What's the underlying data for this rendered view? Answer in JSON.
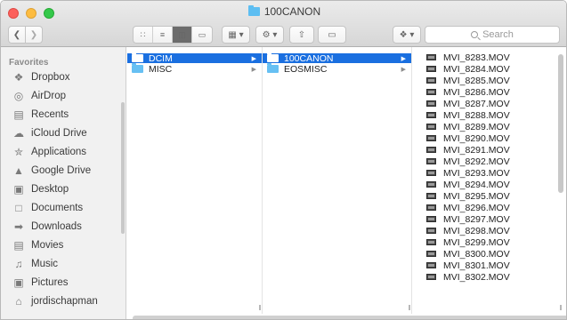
{
  "window": {
    "title": "100CANON"
  },
  "toolbar": {
    "back_icon": "chevron-left-icon",
    "forward_icon": "chevron-right-icon",
    "view_modes": [
      "icon-view-icon",
      "list-view-icon",
      "column-view-icon",
      "cover-flow-icon"
    ],
    "active_view": "column",
    "search_placeholder": "Search"
  },
  "sidebar": {
    "heading": "Favorites",
    "items": [
      {
        "label": "Dropbox",
        "icon": "dropbox-icon"
      },
      {
        "label": "AirDrop",
        "icon": "airdrop-icon"
      },
      {
        "label": "Recents",
        "icon": "recents-icon"
      },
      {
        "label": "iCloud Drive",
        "icon": "cloud-icon"
      },
      {
        "label": "Applications",
        "icon": "applications-icon"
      },
      {
        "label": "Google Drive",
        "icon": "google-drive-icon"
      },
      {
        "label": "Desktop",
        "icon": "desktop-icon"
      },
      {
        "label": "Documents",
        "icon": "documents-icon"
      },
      {
        "label": "Downloads",
        "icon": "downloads-icon"
      },
      {
        "label": "Movies",
        "icon": "movies-icon"
      },
      {
        "label": "Music",
        "icon": "music-icon"
      },
      {
        "label": "Pictures",
        "icon": "pictures-icon"
      },
      {
        "label": "jordischapman",
        "icon": "home-icon"
      }
    ]
  },
  "columns": {
    "col1": [
      {
        "name": "DCIM",
        "selected": true
      },
      {
        "name": "MISC",
        "selected": false
      }
    ],
    "col2": [
      {
        "name": "100CANON",
        "selected": true
      },
      {
        "name": "EOSMISC",
        "selected": false
      }
    ],
    "col3": [
      "MVI_8283.MOV",
      "MVI_8284.MOV",
      "MVI_8285.MOV",
      "MVI_8286.MOV",
      "MVI_8287.MOV",
      "MVI_8288.MOV",
      "MVI_8289.MOV",
      "MVI_8290.MOV",
      "MVI_8291.MOV",
      "MVI_8292.MOV",
      "MVI_8293.MOV",
      "MVI_8294.MOV",
      "MVI_8295.MOV",
      "MVI_8296.MOV",
      "MVI_8297.MOV",
      "MVI_8298.MOV",
      "MVI_8299.MOV",
      "MVI_8300.MOV",
      "MVI_8301.MOV",
      "MVI_8302.MOV"
    ]
  },
  "colors": {
    "selection": "#1a6fe0",
    "folder": "#67c0f3",
    "sidebar_bg": "#f1f1f1"
  }
}
